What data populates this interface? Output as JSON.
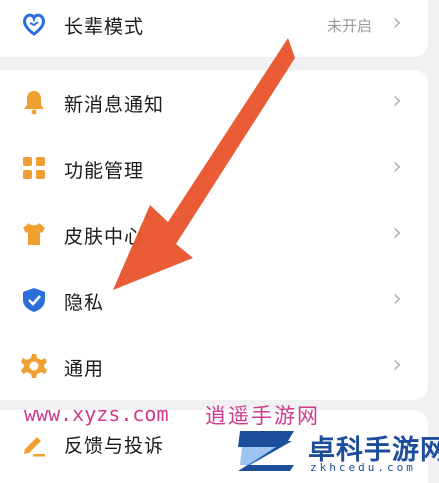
{
  "elder_mode": {
    "label": "长辈模式",
    "status": "未开启"
  },
  "settings_items": [
    {
      "label": "新消息通知",
      "icon": "bell-icon"
    },
    {
      "label": "功能管理",
      "icon": "grid-icon"
    },
    {
      "label": "皮肤中心",
      "icon": "shirt-icon"
    },
    {
      "label": "隐私",
      "icon": "shield-check-icon"
    },
    {
      "label": "通用",
      "icon": "gear-icon"
    }
  ],
  "feedback": {
    "label": "反馈与投诉",
    "icon": "pencil-icon"
  },
  "watermark": {
    "url": "www.xyzs.com",
    "site_name": "逍遥手游网"
  },
  "brand": {
    "title": "卓科手游网",
    "domain": "zkhcedu.com"
  },
  "colors": {
    "accent_orange": "#f0a030",
    "privacy_blue": "#2b6fdc",
    "arrow": "#e8532a",
    "brand_blue": "#1d4e9b"
  }
}
